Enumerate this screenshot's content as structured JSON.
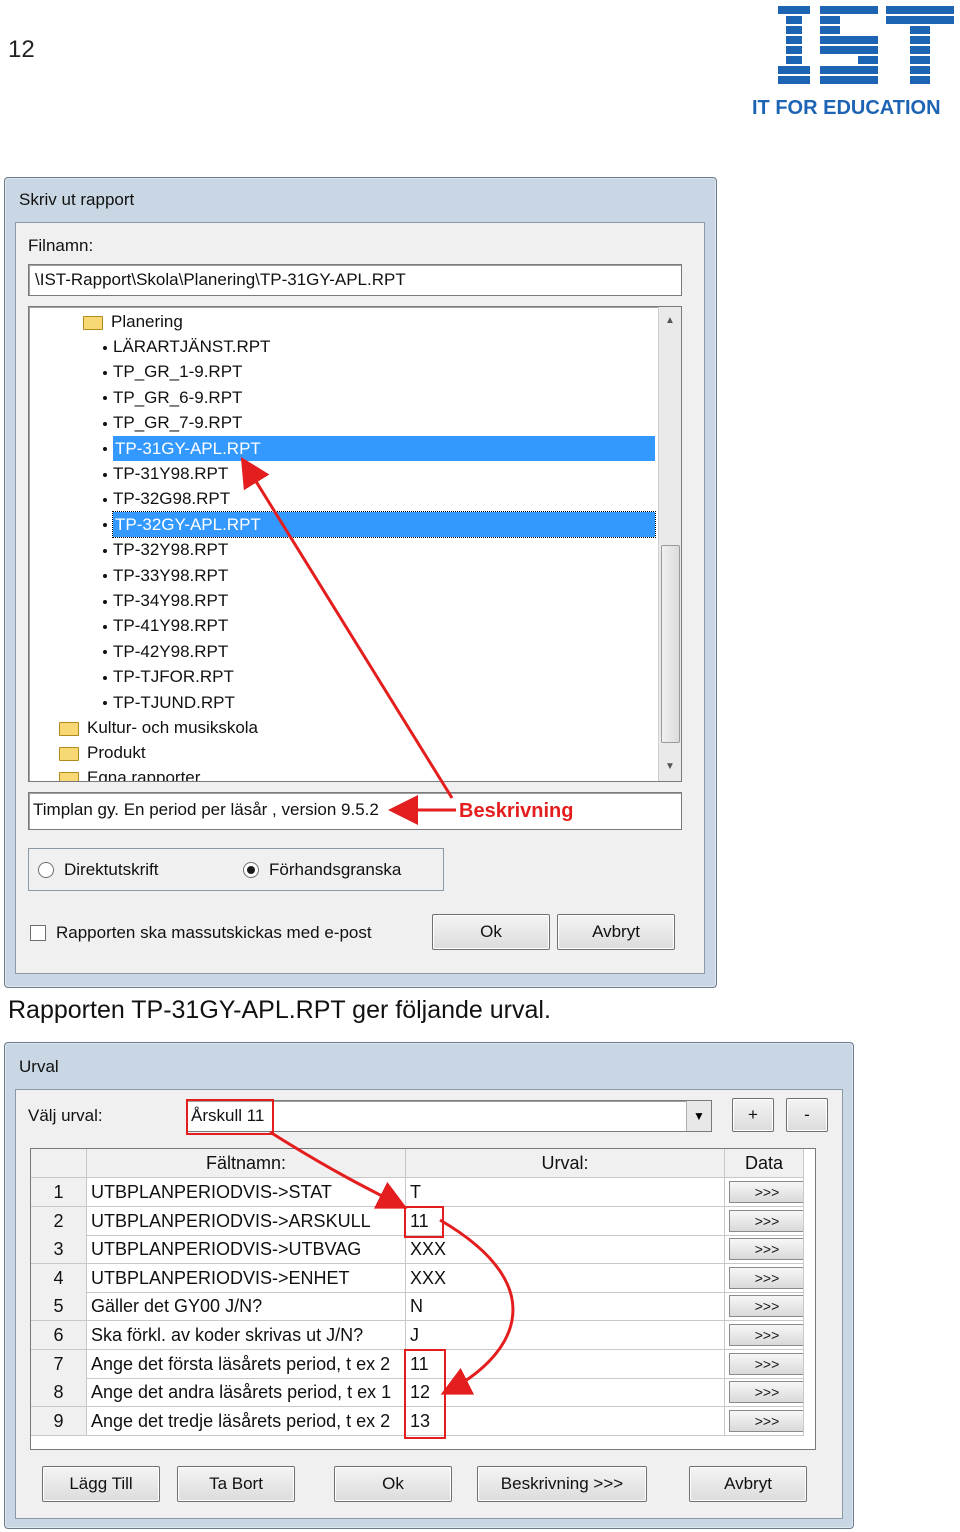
{
  "page_number": "12",
  "logo": {
    "wordmark": "IST",
    "tagline": "IT FOR EDUCATION",
    "color": "#1e64b4"
  },
  "file_dialog": {
    "title": "Skriv ut rapport",
    "filename_label": "Filnamn:",
    "filename_value": "\\IST-Rapport\\Skola\\Planering\\TP-31GY-APL.RPT",
    "tree": {
      "folder_open": "Planering",
      "files": [
        "LÄRARTJÄNST.RPT",
        "TP_GR_1-9.RPT",
        "TP_GR_6-9.RPT",
        "TP_GR_7-9.RPT",
        "TP-31GY-APL.RPT",
        "TP-31Y98.RPT",
        "TP-32G98.RPT",
        "TP-32GY-APL.RPT",
        "TP-32Y98.RPT",
        "TP-33Y98.RPT",
        "TP-34Y98.RPT",
        "TP-41Y98.RPT",
        "TP-42Y98.RPT",
        "TP-TJFOR.RPT",
        "TP-TJUND.RPT"
      ],
      "selected_index": 4,
      "focused_index": 7,
      "folders": [
        "Kultur- och musikskola",
        "Produkt",
        "Egna rapporter"
      ]
    },
    "description_value": "Timplan gy. En period per läsår , version 9.5.2",
    "annotation_label": "Beskrivning",
    "radio_direct": "Direktutskrift",
    "radio_preview": "Förhandsgranska",
    "checkbox_label": "Rapporten ska massutskickas med e-post",
    "ok_label": "Ok",
    "cancel_label": "Avbryt",
    "annotation_color": "#e41e1e"
  },
  "caption": "Rapporten TP-31GY-APL.RPT ger följande urval.",
  "urval_dialog": {
    "title": "Urval",
    "select_label": "Välj urval:",
    "select_value": "Årskull 11",
    "plus_label": "+",
    "minus_label": "-",
    "columns": [
      "Fältnamn:",
      "Urval:",
      "Data"
    ],
    "rows": [
      {
        "num": "1",
        "field": "UTBPLANPERIODVIS->STAT",
        "value": "T",
        "data": ">>>"
      },
      {
        "num": "2",
        "field": "UTBPLANPERIODVIS->ARSKULL",
        "value": "11",
        "data": ">>>"
      },
      {
        "num": "3",
        "field": "UTBPLANPERIODVIS->UTBVAG",
        "value": "XXX",
        "data": ">>>"
      },
      {
        "num": "4",
        "field": "UTBPLANPERIODVIS->ENHET",
        "value": "XXX",
        "data": ">>>"
      },
      {
        "num": "5",
        "field": "Gäller det GY00 J/N?",
        "value": "N",
        "data": ">>>"
      },
      {
        "num": "6",
        "field": "Ska förkl. av koder skrivas ut J/N?",
        "value": "J",
        "data": ">>>"
      },
      {
        "num": "7",
        "field": "Ange det första läsårets period, t ex 2",
        "value": "11",
        "data": ">>>"
      },
      {
        "num": "8",
        "field": "Ange det andra läsårets period, t ex 1",
        "value": "12",
        "data": ">>>"
      },
      {
        "num": "9",
        "field": "Ange det tredje läsårets period, t ex 2",
        "value": "13",
        "data": ">>>"
      }
    ],
    "buttons": {
      "add": "Lägg Till",
      "remove": "Ta Bort",
      "ok": "Ok",
      "describe": "Beskrivning >>>",
      "cancel": "Avbryt"
    }
  }
}
